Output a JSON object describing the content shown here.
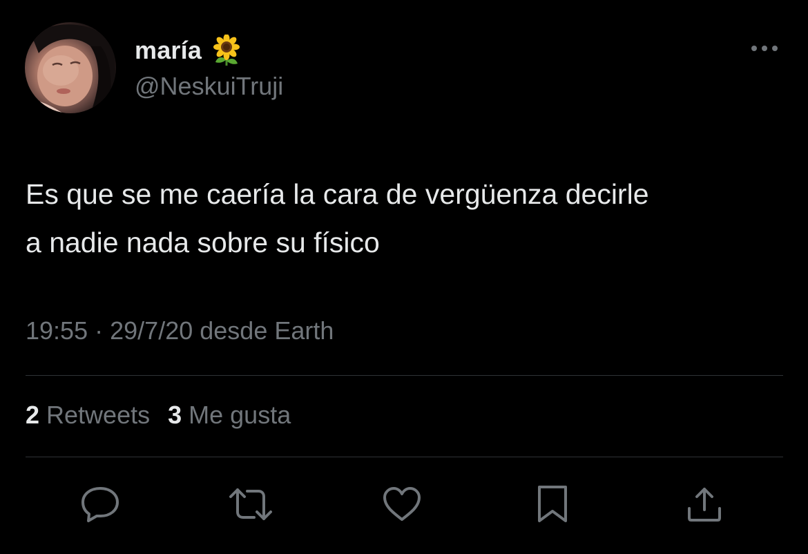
{
  "author": {
    "display_name": "maría",
    "name_emoji": "sunflower-emoji",
    "handle": "@NeskuiTruji"
  },
  "tweet": {
    "text": "Es que se me caería la cara de vergüenza decirle\na nadie nada sobre su físico",
    "time": "19:55",
    "separator": "·",
    "date": "29/7/20",
    "source": "desde Earth"
  },
  "stats": {
    "retweets_count": "2",
    "retweets_label": "Retweets",
    "likes_count": "3",
    "likes_label": "Me gusta"
  },
  "actions": {
    "reply_icon": "reply-icon",
    "retweet_icon": "retweet-icon",
    "like_icon": "heart-icon",
    "bookmark_icon": "bookmark-icon",
    "share_icon": "share-icon"
  },
  "colors": {
    "background": "#000000",
    "primary_text": "#e7e9ea",
    "secondary_text": "#71767b",
    "divider": "#2f3336"
  }
}
